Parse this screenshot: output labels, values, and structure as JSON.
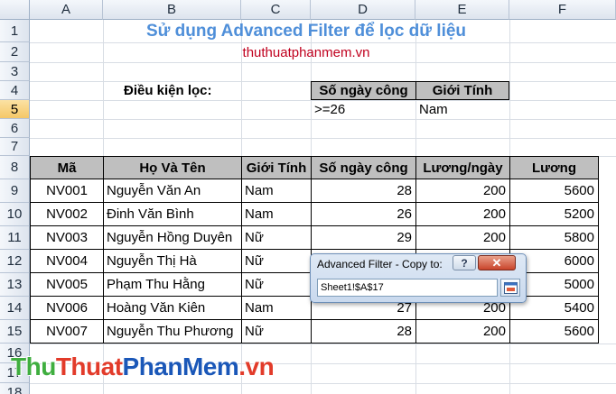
{
  "columns": [
    "A",
    "B",
    "C",
    "D",
    "E",
    "F"
  ],
  "rows": [
    "1",
    "2",
    "3",
    "4",
    "5",
    "6",
    "7",
    "8",
    "9",
    "10",
    "11",
    "12",
    "13",
    "14",
    "15",
    "16",
    "17",
    "18"
  ],
  "title": "Sử dụng Advanced Filter để lọc dữ liệu",
  "subtitle_link": "thuthuatphanmem.vn",
  "criteria": {
    "label": "Điều kiện lọc:",
    "header_days": "Số ngày công",
    "header_gender": "Giới Tính",
    "value_days": ">=26",
    "value_gender": "Nam"
  },
  "table": {
    "headers": [
      "Mã",
      "Họ Và Tên",
      "Giới Tính",
      "Số ngày công",
      "Lương/ngày",
      "Lương"
    ],
    "rows": [
      [
        "NV001",
        "Nguyễn Văn An",
        "Nam",
        "28",
        "200",
        "5600"
      ],
      [
        "NV002",
        "Đinh Văn Bình",
        "Nam",
        "26",
        "200",
        "5200"
      ],
      [
        "NV003",
        "Nguyễn Hồng Duyên",
        "Nữ",
        "29",
        "200",
        "5800"
      ],
      [
        "NV004",
        "Nguyễn Thị Hà",
        "Nữ",
        "",
        "",
        "6000"
      ],
      [
        "NV005",
        "Phạm Thu Hằng",
        "Nữ",
        "",
        "",
        "5000"
      ],
      [
        "NV006",
        "Hoàng Văn Kiên",
        "Nam",
        "27",
        "200",
        "5400"
      ],
      [
        "NV007",
        "Nguyễn Thu Phương",
        "Nữ",
        "28",
        "200",
        "5600"
      ]
    ]
  },
  "dialog": {
    "title": "Advanced Filter - Copy to:",
    "help_label": "?",
    "close_label": "✕",
    "input_value": "Sheet1!$A$17"
  },
  "watermark": {
    "part1": "Thu",
    "part2": "Thuat",
    "part3": "PhanMem",
    "part4": ".vn"
  },
  "colors": {
    "title": "#4f8fd9",
    "link": "#c0001e",
    "header_fill": "#bfbfbf",
    "active_header": "#f5c767"
  }
}
